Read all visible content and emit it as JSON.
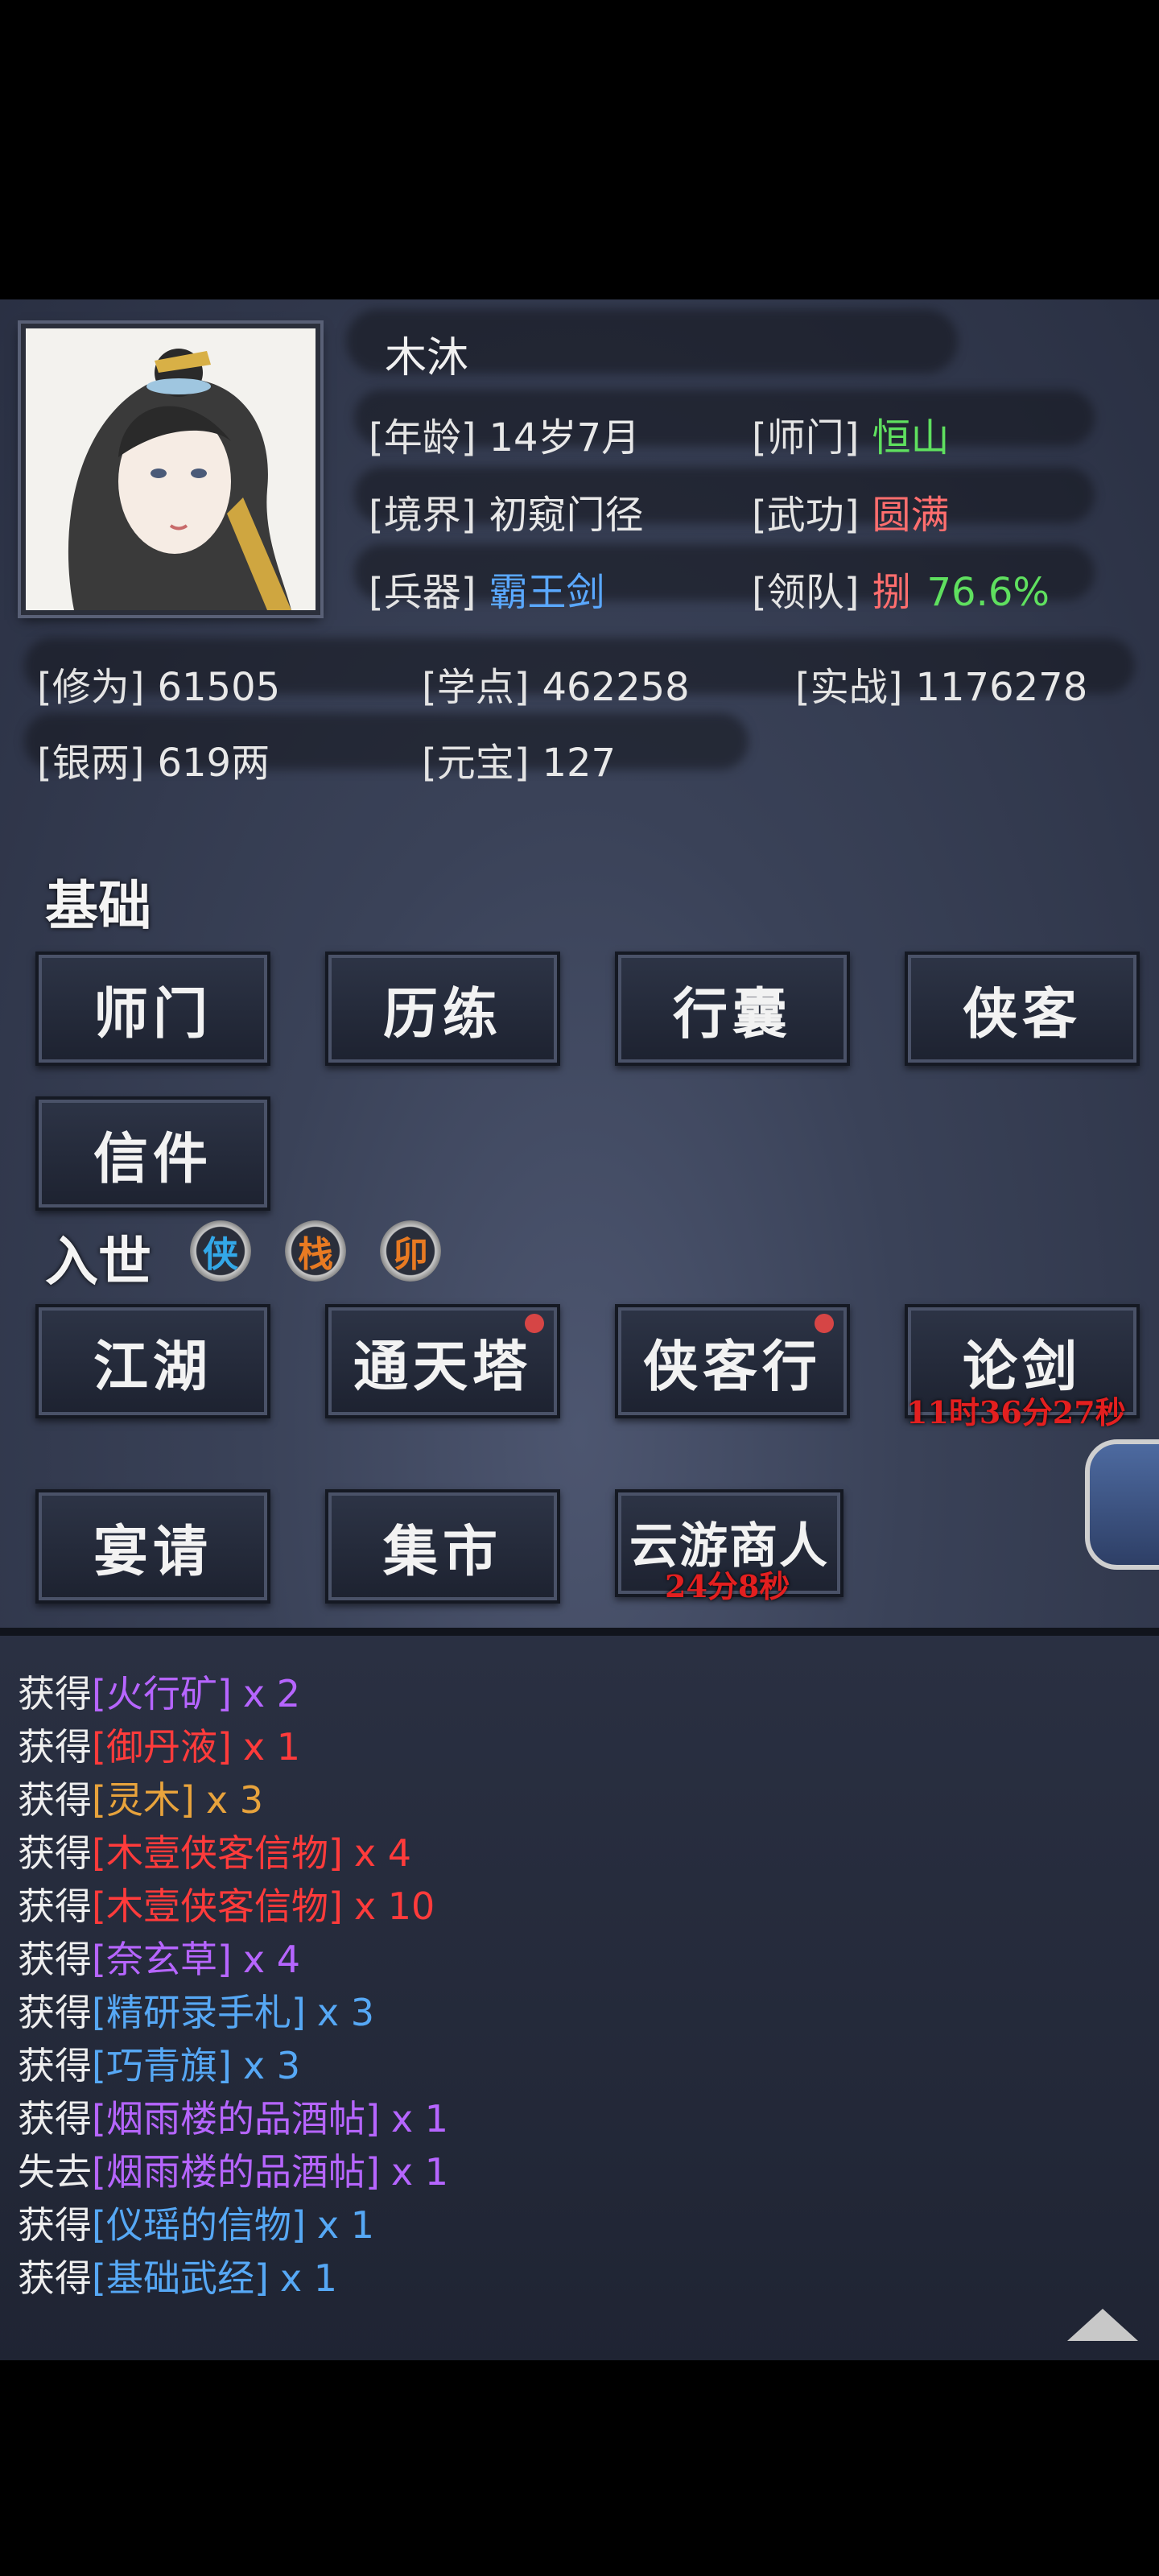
{
  "profile": {
    "name": "木沐",
    "age_label": "[年龄]",
    "age": "14岁7月",
    "sect_label": "[师门]",
    "sect": "恒山",
    "realm_label": "[境界]",
    "realm": "初窥门径",
    "martial_label": "[武功]",
    "martial": "圆满",
    "weapon_label": "[兵器]",
    "weapon": "霸王剑",
    "team_label": "[领队]",
    "team_name": "捌",
    "team_pct": "76.6%"
  },
  "stats": {
    "cultivation_label": "[修为]",
    "cultivation": "61505",
    "study_label": "[学点]",
    "study": "462258",
    "combat_label": "[实战]",
    "combat": "1176278",
    "silver_label": "[银两]",
    "silver": "619两",
    "yuanbao_label": "[元宝]",
    "yuanbao": "127"
  },
  "basic": {
    "title": "基础",
    "buttons": [
      "师门",
      "历练",
      "行囊",
      "侠客",
      "信件"
    ]
  },
  "world": {
    "title": "入世",
    "badges": [
      "侠",
      "栈",
      "卯"
    ],
    "buttons": [
      "江湖",
      "通天塔",
      "侠客行",
      "论剑",
      "宴请",
      "集市",
      "云游商人"
    ],
    "lunjian_timer": "11时36分27秒",
    "merchant_timer": "24分8秒"
  },
  "log": [
    {
      "verb": "获得",
      "item": "[火行矿]",
      "qty": "x 2",
      "color": "purple"
    },
    {
      "verb": "获得",
      "item": "[御丹液]",
      "qty": "x 1",
      "color": "red"
    },
    {
      "verb": "获得",
      "item": "[灵木]",
      "qty": "x 3",
      "color": "orange"
    },
    {
      "verb": "获得",
      "item": "[木壹侠客信物]",
      "qty": "x 4",
      "color": "red"
    },
    {
      "verb": "获得",
      "item": "[木壹侠客信物]",
      "qty": "x 10",
      "color": "red"
    },
    {
      "verb": "获得",
      "item": "[奈玄草]",
      "qty": "x 4",
      "color": "purple"
    },
    {
      "verb": "获得",
      "item": "[精研录手札]",
      "qty": "x 3",
      "color": "blue"
    },
    {
      "verb": "获得",
      "item": "[巧青旗]",
      "qty": "x 3",
      "color": "blue"
    },
    {
      "verb": "获得",
      "item": "[烟雨楼的品酒帖]",
      "qty": "x 1",
      "color": "purple"
    },
    {
      "verb": "失去",
      "item": "[烟雨楼的品酒帖]",
      "qty": "x 1",
      "color": "purple"
    },
    {
      "verb": "获得",
      "item": "[仪瑶的信物]",
      "qty": "x 1",
      "color": "blue"
    },
    {
      "verb": "获得",
      "item": "[基础武经]",
      "qty": "x 1",
      "color": "blue"
    }
  ],
  "colors": {
    "purple": "#b665ff",
    "red": "#ff3b3b",
    "orange": "#e8a33c",
    "blue": "#56a8f5",
    "green": "#5fe05f",
    "timer": "#e31f1f"
  }
}
